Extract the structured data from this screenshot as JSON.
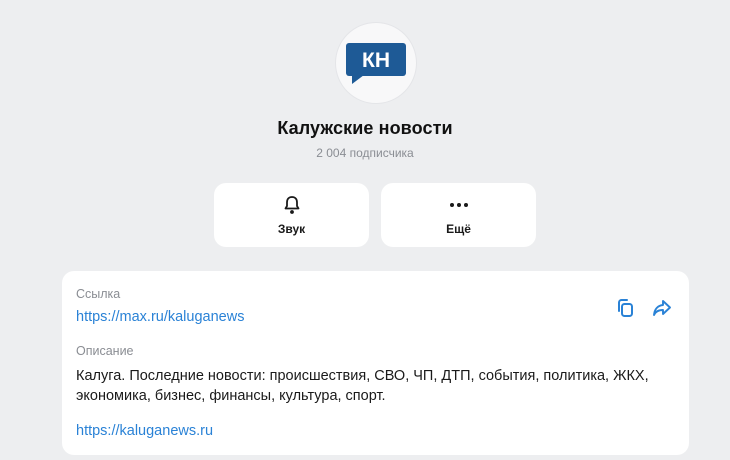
{
  "channel": {
    "logo_text": "КН",
    "name": "Калужские новости",
    "subscribers": "2 004 подписчика",
    "brand_color": "#1e5a96"
  },
  "actions": {
    "sound_label": "Звук",
    "sound_icon": "bell-icon",
    "more_label": "Ещё",
    "more_icon": "more-dots-icon"
  },
  "info": {
    "link_label": "Ссылка",
    "link_value": "https://max.ru/kaluganews",
    "description_label": "Описание",
    "description_text": "Калуга. Последние новости: происшествия, СВО, ЧП, ДТП, события, политика, ЖКХ, экономика, бизнес, финансы, культура, спорт.",
    "website": "https://kaluganews.ru",
    "copy_icon": "copy-icon",
    "share_icon": "share-icon",
    "accent_color": "#2a82d6"
  }
}
